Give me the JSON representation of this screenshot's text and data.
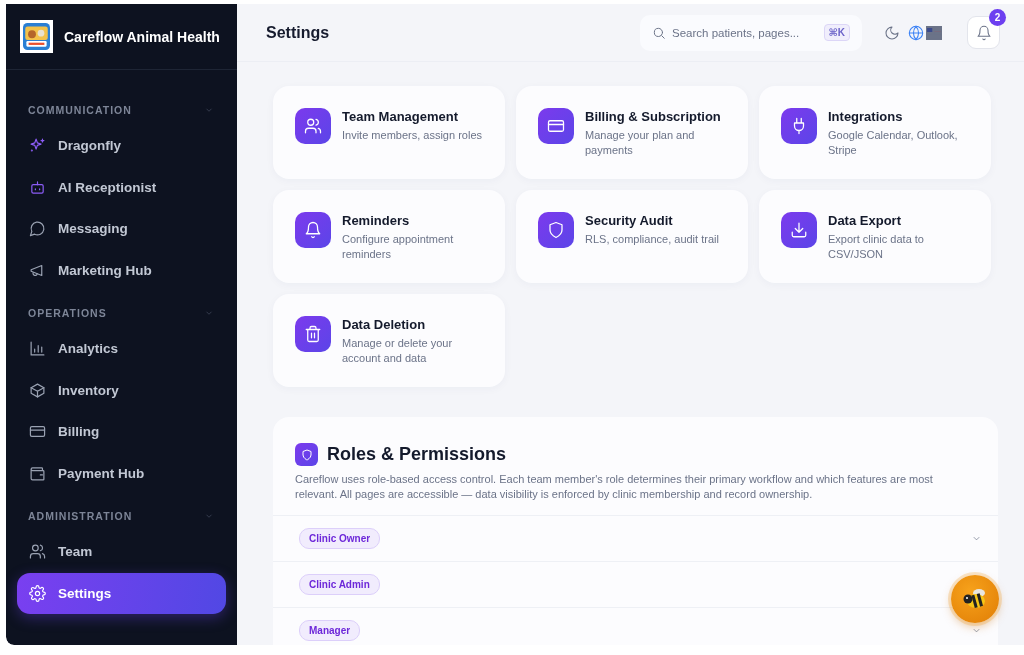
{
  "sidebar": {
    "brand": "Careflow Animal Health",
    "sections": [
      {
        "title": "COMMUNICATION",
        "expanded": true,
        "items": [
          {
            "label": "Dragonfly",
            "selected": false
          },
          {
            "label": "AI Receptionist",
            "selected": false
          },
          {
            "label": "Messaging",
            "selected": false
          },
          {
            "label": "Marketing Hub",
            "selected": false
          }
        ]
      },
      {
        "title": "OPERATIONS",
        "expanded": true,
        "items": [
          {
            "label": "Analytics",
            "selected": false
          },
          {
            "label": "Inventory",
            "selected": false
          },
          {
            "label": "Billing",
            "selected": false
          },
          {
            "label": "Payment Hub",
            "selected": false
          }
        ]
      },
      {
        "title": "ADMINISTRATION",
        "expanded": true,
        "items": [
          {
            "label": "Team",
            "selected": false
          },
          {
            "label": "Settings",
            "selected": true
          }
        ]
      }
    ]
  },
  "header": {
    "title": "Settings",
    "search": {
      "placeholder": "Search patients, pages...",
      "shortcut": "⌘K"
    },
    "notifications": "2"
  },
  "cards": [
    {
      "title": "Team Management",
      "description": "Invite members, assign roles"
    },
    {
      "title": "Billing & Subscription",
      "description": "Manage your plan and payments"
    },
    {
      "title": "Integrations",
      "description": "Google Calendar, Outlook, Stripe"
    },
    {
      "title": "Reminders",
      "description": "Configure appointment reminders"
    },
    {
      "title": "Security Audit",
      "description": "RLS, compliance, audit trail"
    },
    {
      "title": "Data Export",
      "description": "Export clinic data to CSV/JSON"
    },
    {
      "title": "Data Deletion",
      "description": "Manage or delete your account and data"
    }
  ],
  "roles": {
    "title": "Roles & Permissions",
    "description": "Careflow uses role-based access control. Each team member's role determines their primary workflow and which features are most relevant. All pages are accessible — data visibility is enforced by clinic membership and record ownership.",
    "items": [
      {
        "label": "Clinic Owner",
        "expanded": false
      },
      {
        "label": "Clinic Admin"
      },
      {
        "label": "Manager",
        "expanded": false
      }
    ]
  }
}
